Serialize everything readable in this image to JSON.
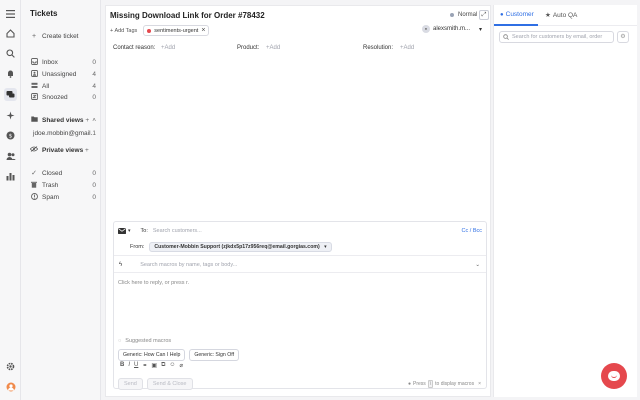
{
  "rail": {
    "icons": [
      "menu-icon",
      "home-icon",
      "search-icon",
      "bell-icon",
      "chat-icon",
      "automation-icon",
      "dollar-icon",
      "users-icon",
      "stats-icon",
      "settings-icon",
      "avatar"
    ]
  },
  "sidebar": {
    "title": "Tickets",
    "create": "Create ticket",
    "views": [
      {
        "label": "Inbox",
        "count": "0"
      },
      {
        "label": "Unassigned",
        "count": "4"
      },
      {
        "label": "All",
        "count": "4"
      },
      {
        "label": "Snoozed",
        "count": "0"
      }
    ],
    "shared_views": "Shared views",
    "shared_items": [
      {
        "label": "jdoe.mobbin@gmail.",
        "count": "1"
      }
    ],
    "private_views": "Private views",
    "status_views": [
      {
        "label": "Closed",
        "count": "0"
      },
      {
        "label": "Trash",
        "count": "0"
      },
      {
        "label": "Spam",
        "count": "0"
      }
    ]
  },
  "ticket": {
    "title": "Missing Download Link for Order #78432",
    "priority": "Normal",
    "add_tags": "Add Tags",
    "tag": "sentiments-urgent",
    "assignee": "alexsmith.m...",
    "fields": {
      "contact_reason": "Contact reason:",
      "contact_reason_ph": "+Add",
      "product": "Product:",
      "product_ph": "+Add",
      "resolution": "Resolution:",
      "resolution_ph": "+Add"
    }
  },
  "composer": {
    "to_label": "To:",
    "to_placeholder": "Search customers...",
    "cc_bcc": "Cc / Bcc",
    "from_label": "From:",
    "from_value": "Customer-Mobbin Support (zjkdx5p17z956req@email.gorgias.com)",
    "macro_placeholder": "Search macros by name, tags or body...",
    "reply_placeholder": "Click here to reply, or press r.",
    "suggested_label": "Suggested macros",
    "macros": [
      "Generic: How Can I Help",
      "Generic: Sign Off"
    ],
    "send": "Send",
    "send_close": "Send & Close",
    "hint_prefix": "Press",
    "hint_key": "\\",
    "hint_suffix": "to display macros"
  },
  "rpanel": {
    "tab_customer": "Customer",
    "tab_autoqa": "Auto QA",
    "search_placeholder": "Search for customers by email, order"
  },
  "colors": {
    "accent": "#2f6fe4",
    "brand_red": "#e5484d"
  }
}
